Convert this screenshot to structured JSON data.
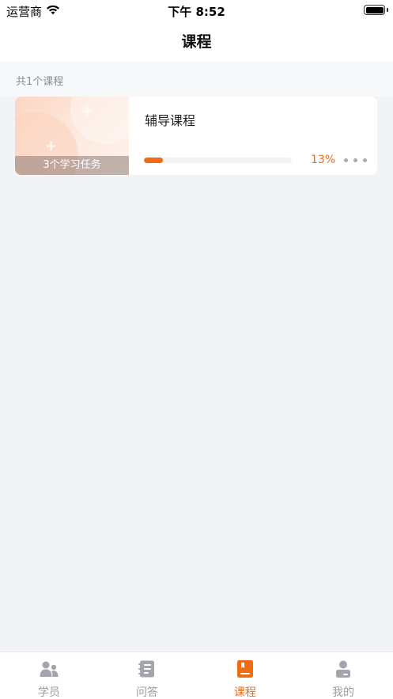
{
  "status_bar": {
    "carrier": "运营商",
    "time": "下午 8:52"
  },
  "nav": {
    "title": "课程"
  },
  "course_list": {
    "count_text": "共1个课程",
    "courses": [
      {
        "name": "辅导课程",
        "task_count_label": "3个学习任务",
        "progress_percent": 13,
        "progress_text": "13%"
      }
    ]
  },
  "tab_bar": {
    "tabs": [
      {
        "label": "学员",
        "icon": "students-icon",
        "active": false
      },
      {
        "label": "问答",
        "icon": "qa-icon",
        "active": false
      },
      {
        "label": "课程",
        "icon": "course-icon",
        "active": true
      },
      {
        "label": "我的",
        "icon": "profile-icon",
        "active": false
      }
    ]
  },
  "colors": {
    "accent": "#f06b12",
    "inactive_tab": "#9a9ca3",
    "page_background": "#f2f3f7"
  }
}
